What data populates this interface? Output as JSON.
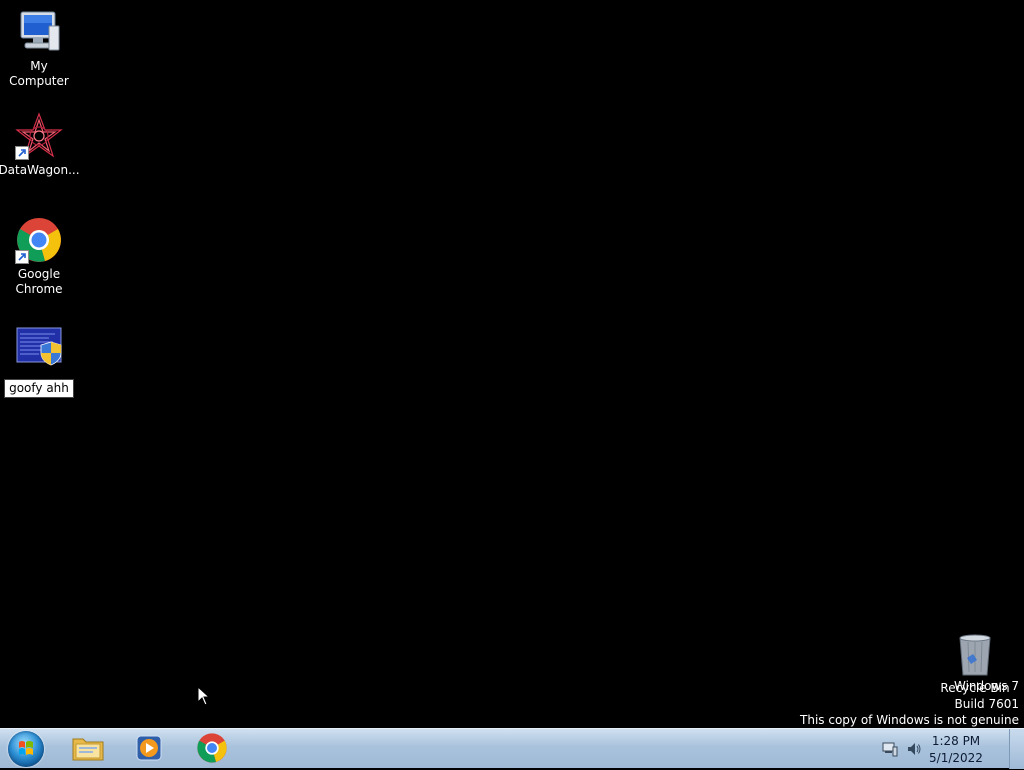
{
  "desktop": {
    "icons": [
      {
        "label": "My Computer",
        "icon": "computer-icon"
      },
      {
        "label": "DataWagon...",
        "icon": "datawagon-icon"
      },
      {
        "label": "Google Chrome",
        "icon": "chrome-icon"
      },
      {
        "label": "goofy ahh",
        "icon": "script-shield-icon"
      },
      {
        "label": "Recycle Bin",
        "icon": "recycle-bin-icon"
      }
    ],
    "watermark": {
      "line1": "Windows 7",
      "line2": "Build 7601",
      "line3": "This copy of Windows is not genuine"
    }
  },
  "taskbar": {
    "start": "start-orb-icon",
    "pinned": [
      {
        "name": "Windows Explorer",
        "icon": "folder-icon"
      },
      {
        "name": "Windows Media Player",
        "icon": "media-player-icon"
      },
      {
        "name": "Google Chrome",
        "icon": "chrome-icon"
      }
    ],
    "clock": {
      "time": "1:28 PM",
      "date": "5/1/2022"
    }
  },
  "colors": {
    "desktop": "#000000",
    "taskbar": "#a9c2dc",
    "selection": "#ffffff"
  }
}
